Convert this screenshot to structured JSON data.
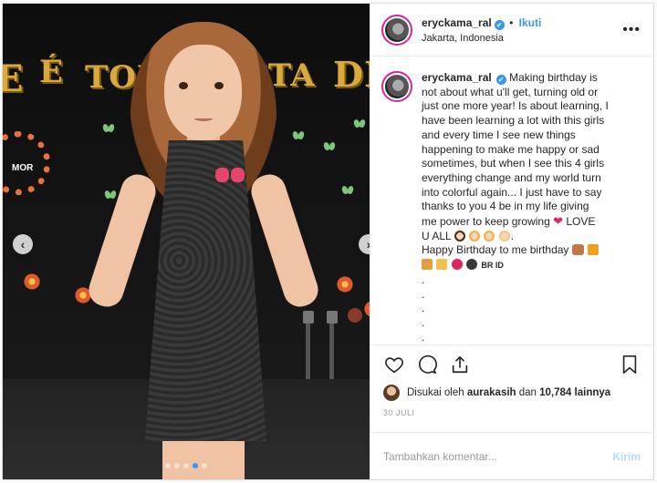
{
  "header": {
    "username": "eryckama_ral",
    "verified_mark": "✔",
    "separator": "•",
    "follow_label": "Ikuti",
    "location": "Jakarta, Indonesia",
    "more_icon": "more-horizontal-icon",
    "more_glyph": "•••"
  },
  "media": {
    "banner_text": "E É TODA   FESTA DE",
    "wreath_text": "MOR",
    "prev_arrow": "‹",
    "next_arrow": "›",
    "carousel_count": 5,
    "carousel_active": 4
  },
  "caption": {
    "username": "eryckama_ral",
    "lines": [
      "Making birthday is",
      "not about what u'll get, turning old or",
      "just one more year! Is about learning, I",
      "have been learning a lot with this girls",
      "and every time I see new things",
      "happening to make me happy or sad",
      "sometimes, but when I see this 4 girls",
      "everything change and my world turn",
      "into colorful again... I just have to say",
      "thanks to you 4 be in my life giving",
      "me power to keep growing",
      "LOVE",
      "U ALL",
      ".",
      "Happy Birthday to me birthday",
      "BR ID",
      ".",
      ".",
      ".",
      ".",
      "."
    ]
  },
  "actions": {
    "like_icon": "heart-icon",
    "comment_icon": "comment-icon",
    "share_icon": "share-icon",
    "save_icon": "bookmark-icon"
  },
  "likes": {
    "prefix": "Disukai oleh",
    "user": "aurakasih",
    "middle": "dan",
    "count": "10,784",
    "suffix": "lainnya"
  },
  "date": "30 JULI",
  "comment": {
    "placeholder": "Tambahkan komentar...",
    "post_label": "Kirim"
  },
  "colors": {
    "accent": "#3897f0",
    "story_ring": "#d6249f",
    "heart": "#e0245e"
  }
}
